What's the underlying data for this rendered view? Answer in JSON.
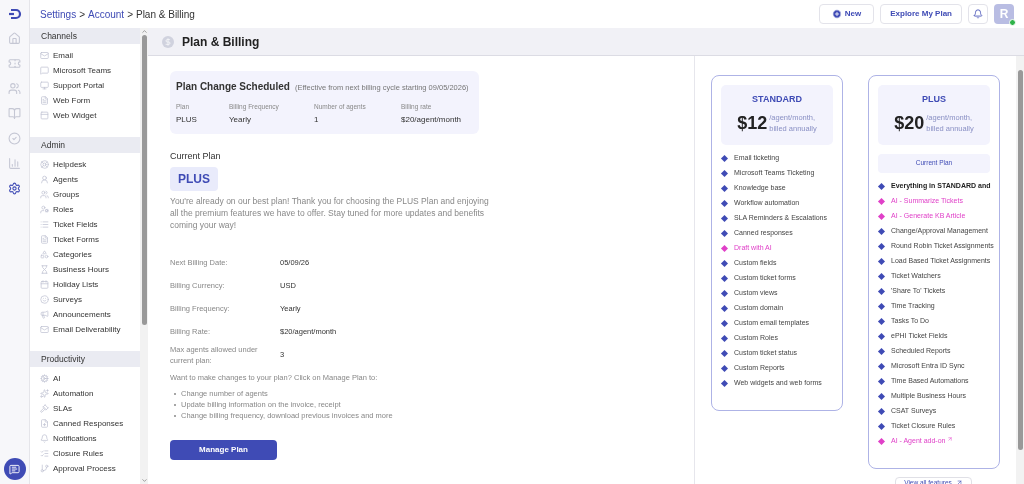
{
  "breadcrumb": [
    {
      "label": "Settings",
      "kind": "link"
    },
    {
      "label": ">",
      "kind": "separator"
    },
    {
      "label": "Account",
      "kind": "link"
    },
    {
      "label": ">",
      "kind": "separator"
    },
    {
      "label": "Plan & Billing",
      "kind": "current"
    }
  ],
  "top_actions": {
    "new_button": "New",
    "explore_button": "Explore My Plan",
    "avatar": "R",
    "online": true
  },
  "rail": [
    {
      "selected": false
    },
    {
      "selected": false
    },
    {
      "selected": false
    },
    {
      "selected": false
    },
    {
      "selected": false
    },
    {
      "selected": false
    },
    {
      "selected": true
    }
  ],
  "sidebar": [
    {
      "title": "Channels",
      "items": [
        "Email",
        "Microsoft Teams",
        "Support Portal",
        "Web Form",
        "Web Widget"
      ]
    },
    {
      "title": "Admin",
      "items": [
        "Helpdesk",
        "Agents",
        "Groups",
        "Roles",
        "Ticket Fields",
        "Ticket Forms",
        "Categories",
        "Business Hours",
        "Holiday Lists",
        "Surveys",
        "Announcements",
        "Email Deliverability"
      ]
    },
    {
      "title": "Productivity",
      "items": [
        "AI",
        "Automation",
        "SLAs",
        "Canned Responses",
        "Notifications",
        "Closure Rules",
        "Approval Process"
      ]
    }
  ],
  "page_title": "Plan & Billing",
  "scheduled": {
    "title": "Plan Change Scheduled",
    "note": "(Effective from next billing cycle starting 09/05/2026)",
    "fields": [
      {
        "label": "Plan",
        "value": "PLUS"
      },
      {
        "label": "Billing Frequency",
        "value": "Yearly"
      },
      {
        "label": "Number of agents",
        "value": "1"
      },
      {
        "label": "Billing rate",
        "value": "$20/agent/month"
      }
    ]
  },
  "current_plan": {
    "label": "Current Plan",
    "plan": "PLUS",
    "message": "You're already on our best plan! Thank you for choosing the PLUS Plan and enjoying all the premium features we have to offer. Stay tuned for more updates and benefits coming your way!"
  },
  "details": [
    {
      "label": "Next Billing Date:",
      "value": "05/09/26"
    },
    {
      "label": "Billing Currency:",
      "value": "USD"
    },
    {
      "label": "Billing Frequency:",
      "value": "Yearly"
    },
    {
      "label": "Billing Rate:",
      "value": "$20/agent/month"
    },
    {
      "label": "Max agents allowed under current plan:",
      "value": "3"
    }
  ],
  "changes": {
    "intro": "Want to make changes to your plan? Click on Manage Plan to:",
    "items": [
      "Change number of agents",
      "Update billing information on the invoice, receipt",
      "Change billing frequency, download previous invoices and more"
    ],
    "button": "Manage Plan"
  },
  "plans": [
    {
      "name": "STANDARD",
      "price": "$12",
      "unit": "/agent/month,",
      "billing": "billed annually",
      "features": [
        {
          "label": "Email ticketing",
          "kind": "regular"
        },
        {
          "label": "Microsoft Teams Ticketing",
          "kind": "regular"
        },
        {
          "label": "Knowledge base",
          "kind": "regular"
        },
        {
          "label": "Workflow automation",
          "kind": "regular"
        },
        {
          "label": "SLA Reminders & Escalations",
          "kind": "regular"
        },
        {
          "label": "Canned responses",
          "kind": "regular"
        },
        {
          "label": "Draft with AI",
          "kind": "ai"
        },
        {
          "label": "Custom fields",
          "kind": "regular"
        },
        {
          "label": "Custom ticket forms",
          "kind": "regular"
        },
        {
          "label": "Custom views",
          "kind": "regular"
        },
        {
          "label": "Custom domain",
          "kind": "regular"
        },
        {
          "label": "Custom email templates",
          "kind": "regular"
        },
        {
          "label": "Custom Roles",
          "kind": "regular"
        },
        {
          "label": "Custom ticket status",
          "kind": "regular"
        },
        {
          "label": "Custom Reports",
          "kind": "regular"
        },
        {
          "label": "Web widgets and web forms",
          "kind": "regular"
        }
      ]
    },
    {
      "name": "PLUS",
      "price": "$20",
      "unit": "/agent/month,",
      "billing": "billed annually",
      "current_label": "Current Plan",
      "features": [
        {
          "label": "Everything in STANDARD and",
          "kind": "heading"
        },
        {
          "label": "AI - Summarize Tickets",
          "kind": "ai"
        },
        {
          "label": "AI - Generate KB Article",
          "kind": "ai"
        },
        {
          "label": "Change/Approval Management",
          "kind": "regular"
        },
        {
          "label": "Round Robin Ticket Assignments",
          "kind": "regular"
        },
        {
          "label": "Load Based Ticket Assignments",
          "kind": "regular"
        },
        {
          "label": "Ticket Watchers",
          "kind": "regular"
        },
        {
          "label": "'Share To' Tickets",
          "kind": "regular"
        },
        {
          "label": "Time Tracking",
          "kind": "regular"
        },
        {
          "label": "Tasks To Do",
          "kind": "regular"
        },
        {
          "label": "ePHI Ticket Fields",
          "kind": "regular"
        },
        {
          "label": "Scheduled Reports",
          "kind": "regular"
        },
        {
          "label": "Microsoft Entra ID Sync",
          "kind": "regular"
        },
        {
          "label": "Time Based Automations",
          "kind": "regular"
        },
        {
          "label": "Multiple Business Hours",
          "kind": "regular"
        },
        {
          "label": "CSAT Surveys",
          "kind": "regular"
        },
        {
          "label": "Ticket Closure Rules",
          "kind": "regular"
        },
        {
          "label": "AI - Agent add-on",
          "kind": "ai_link"
        }
      ]
    }
  ],
  "view_all": "View all features"
}
